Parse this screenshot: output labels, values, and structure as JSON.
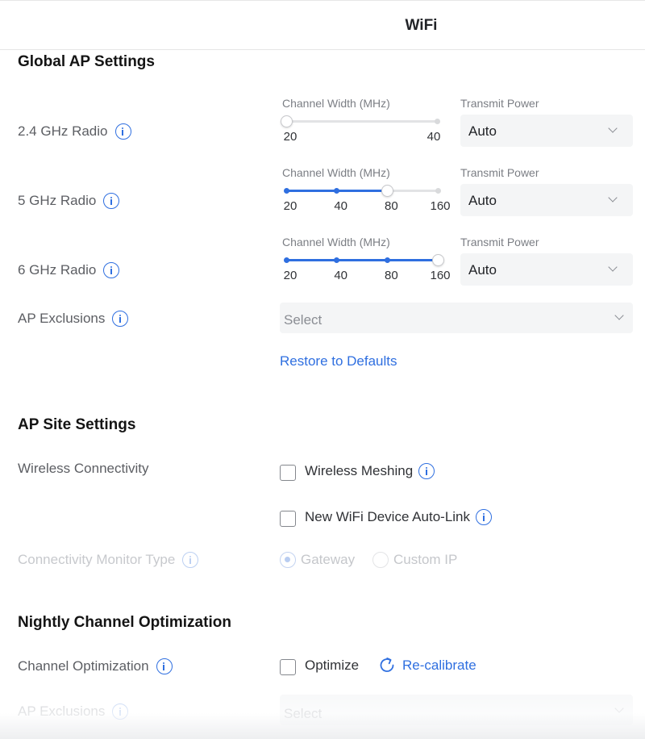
{
  "header": {
    "title": "WiFi"
  },
  "global_ap": {
    "title": "Global AP Settings",
    "radios": [
      {
        "label": "2.4 GHz Radio",
        "channel_width_label": "Channel Width (MHz)",
        "options": [
          "20",
          "40"
        ],
        "selected": "20",
        "transmit_power_label": "Transmit Power",
        "transmit_power_value": "Auto"
      },
      {
        "label": "5 GHz Radio",
        "channel_width_label": "Channel Width (MHz)",
        "options": [
          "20",
          "40",
          "80",
          "160"
        ],
        "selected": "80",
        "transmit_power_label": "Transmit Power",
        "transmit_power_value": "Auto"
      },
      {
        "label": "6 GHz Radio",
        "channel_width_label": "Channel Width (MHz)",
        "options": [
          "20",
          "40",
          "80",
          "160"
        ],
        "selected": "160",
        "transmit_power_label": "Transmit Power",
        "transmit_power_value": "Auto"
      }
    ],
    "ap_exclusions": {
      "label": "AP Exclusions",
      "placeholder": "Select"
    },
    "restore_label": "Restore to Defaults"
  },
  "site": {
    "title": "AP Site Settings",
    "wireless_connectivity_label": "Wireless Connectivity",
    "wireless_meshing_label": "Wireless Meshing",
    "wireless_meshing_checked": false,
    "auto_link_label": "New WiFi Device Auto-Link",
    "auto_link_checked": false,
    "monitor_type_label": "Connectivity Monitor Type",
    "monitor_options": [
      "Gateway",
      "Custom IP"
    ],
    "monitor_selected": "Gateway"
  },
  "nightly": {
    "title": "Nightly Channel Optimization",
    "channel_opt_label": "Channel Optimization",
    "optimize_label": "Optimize",
    "optimize_checked": false,
    "recalibrate_label": "Re-calibrate",
    "ap_exclusions_label": "AP Exclusions",
    "ap_exclusions_placeholder": "Select"
  },
  "colors": {
    "accent": "#2f6fe0",
    "track": "#e2e3e5",
    "field_bg": "#f4f5f6"
  },
  "icons": [
    "info-icon",
    "chevron-down-icon",
    "refresh-icon"
  ]
}
